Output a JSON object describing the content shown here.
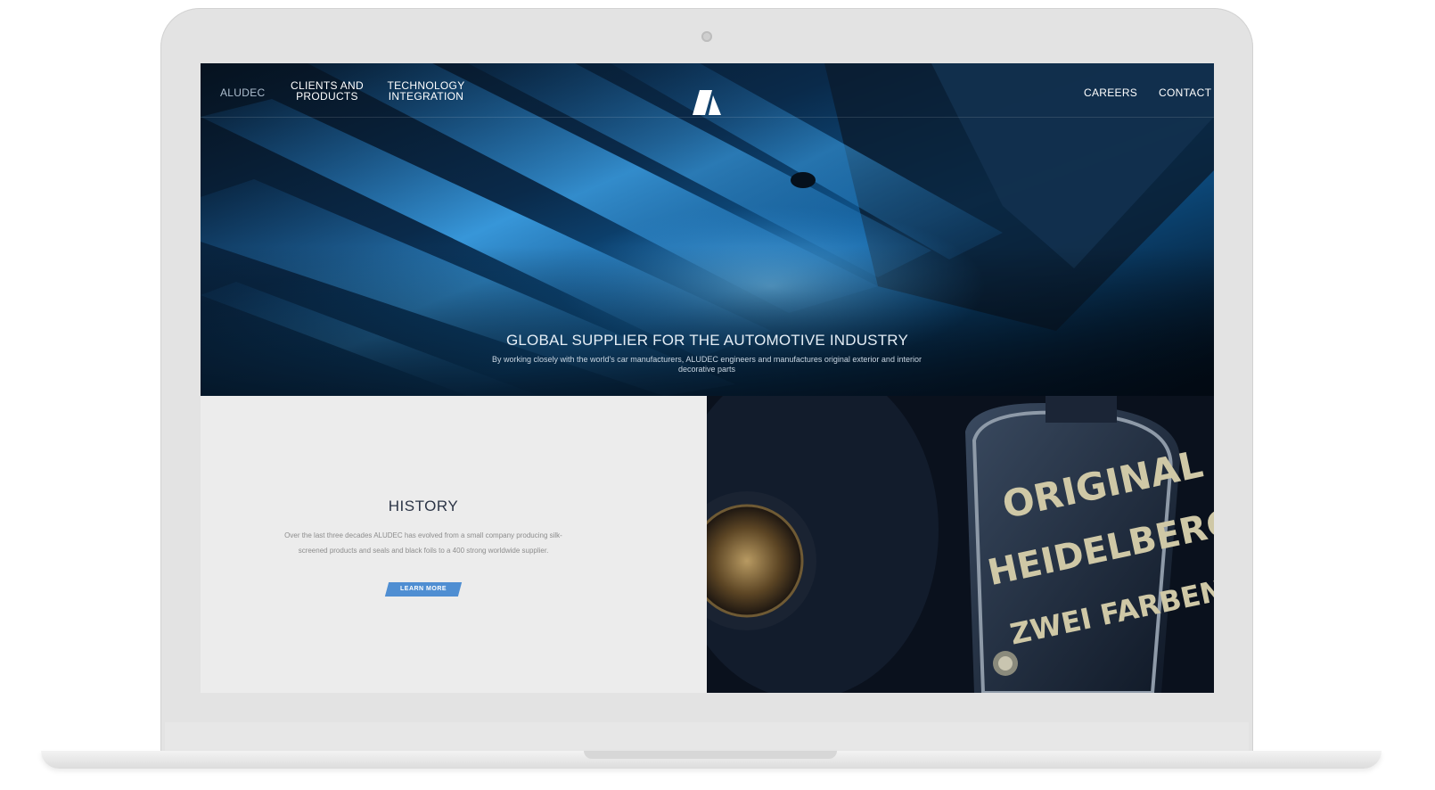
{
  "nav": {
    "brand": "ALUDEC",
    "items": [
      {
        "line1": "CLIENTS AND",
        "line2": "PRODUCTS"
      },
      {
        "line1": "TECHNOLOGY",
        "line2": "INTEGRATION"
      }
    ],
    "careers": "CAREERS",
    "contact": "CONTACT"
  },
  "hero": {
    "title": "GLOBAL SUPPLIER FOR THE AUTOMOTIVE INDUSTRY",
    "subtitle": "By working closely with the world's car manufacturers, ALUDEC engineers and manufactures original exterior and interior decorative parts"
  },
  "history": {
    "title": "HISTORY",
    "text": "Over the last three decades ALUDEC has evolved from a small company producing silk-screened products and seals and black foils to a 400 strong worldwide supplier.",
    "button": "LEARN MORE"
  },
  "machine_plate": {
    "line1": "ORIGINAL",
    "line2": "HEIDELBERG",
    "line3": "ZWEI FARBEN"
  },
  "colors": {
    "accent": "#4f8ed2",
    "history_bg": "#ececec",
    "heading": "#2b3446"
  }
}
